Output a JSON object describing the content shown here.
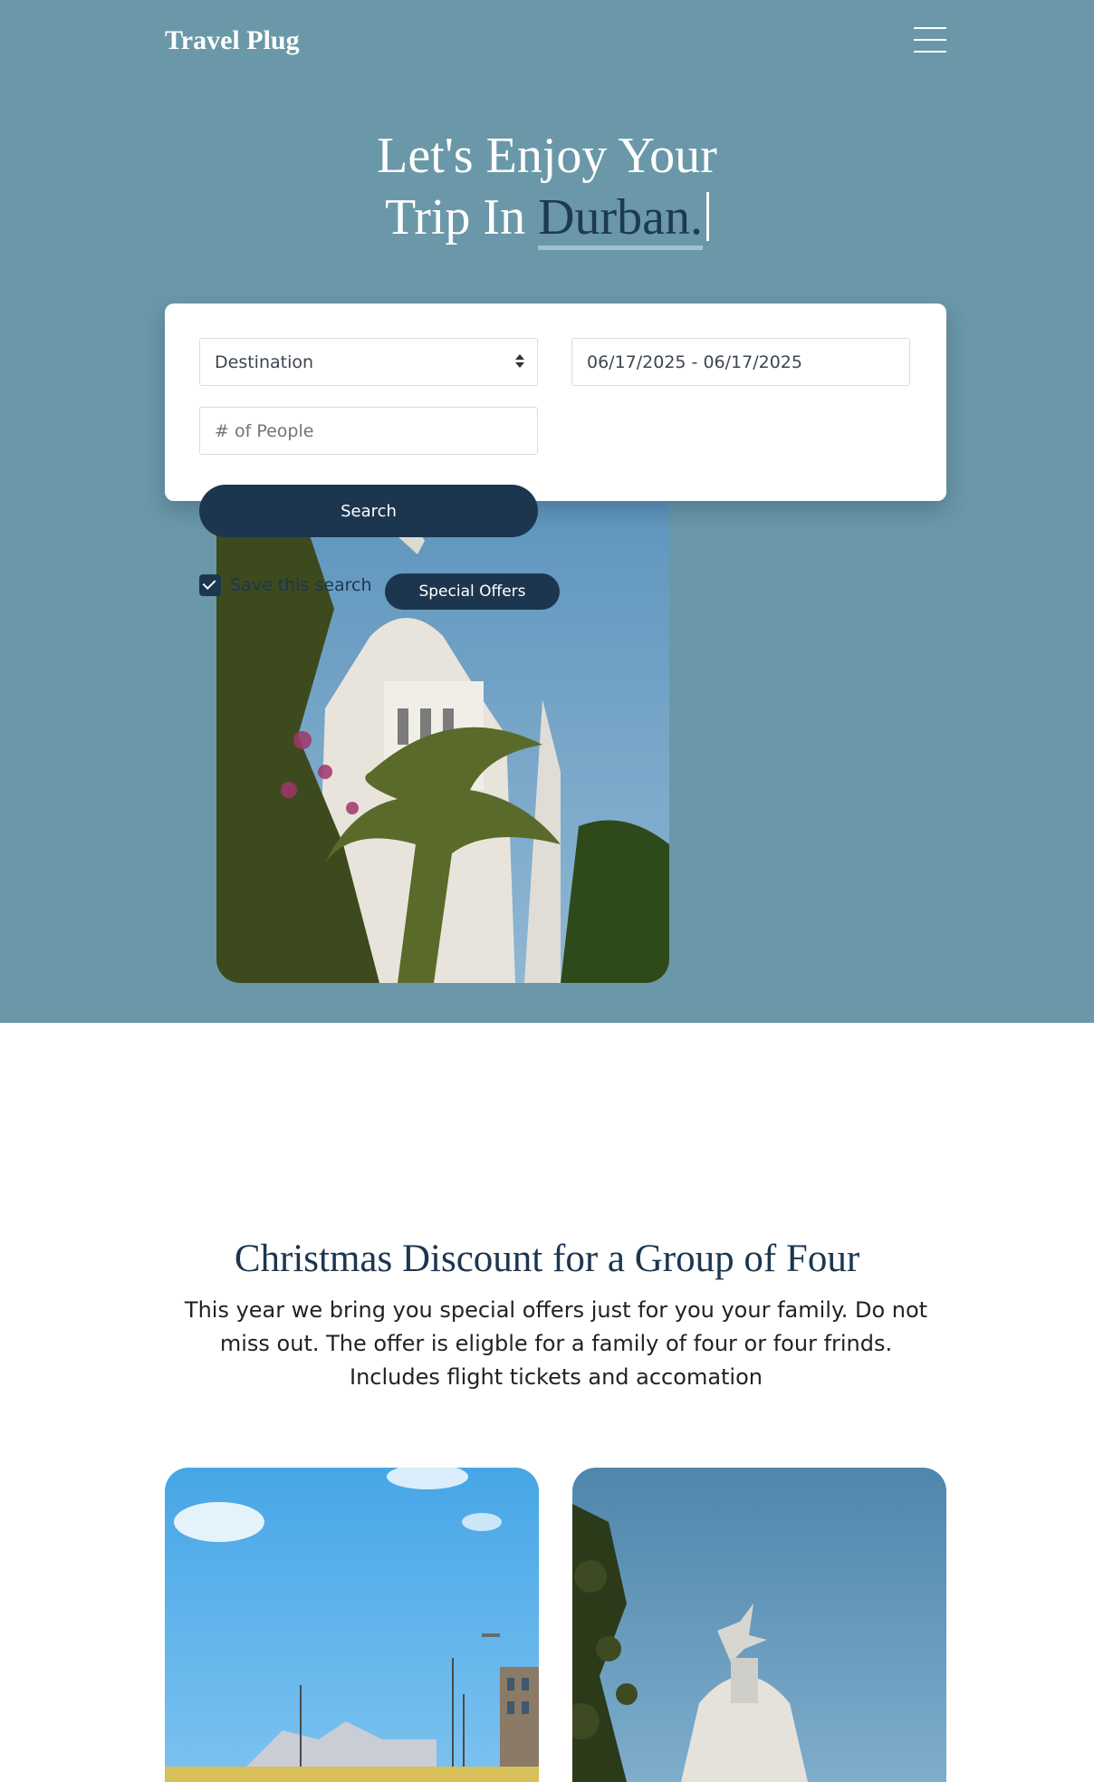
{
  "header": {
    "brand": "Travel Plug",
    "menu_icon": "hamburger-menu-icon"
  },
  "hero": {
    "headline_line1": "Let's Enjoy Your",
    "headline_prefix": "Trip In",
    "headline_city": "Durban."
  },
  "search_form": {
    "destination_value": "Destination",
    "dates_value": "06/17/2025 - 06/17/2025",
    "people_placeholder": "# of People",
    "search_label": "Search",
    "save_label": "Save this search",
    "save_checked": true,
    "offers_label": "Special Offers"
  },
  "promo": {
    "title": "Christmas Discount for a Group of Four",
    "text": "This year we bring you special offers just for you your family. Do not miss out. The offer is eligble for a family of four or four frinds. Includes flight tickets and accomation"
  },
  "colors": {
    "hero_bg": "#6a98a9",
    "primary": "#1c3650",
    "accent_underline": "#9fc1d4"
  }
}
